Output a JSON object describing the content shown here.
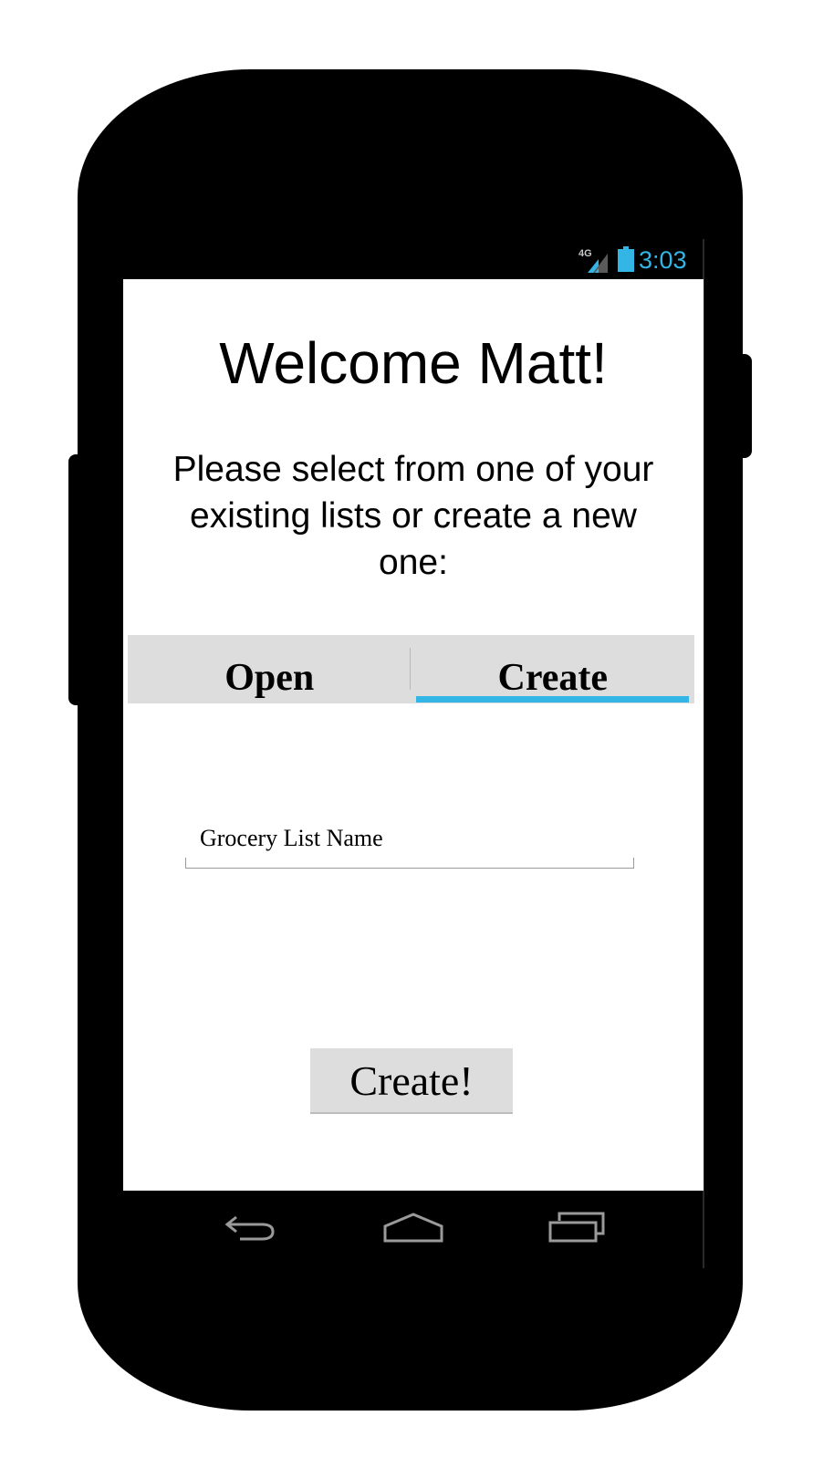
{
  "status_bar": {
    "network_label": "4G",
    "time": "3:03",
    "accent_color": "#33b5e5"
  },
  "screen": {
    "title": "Welcome Matt!",
    "subtitle": "Please select from one of your existing lists or create a new one:",
    "tabs": [
      {
        "label": "Open",
        "selected": false
      },
      {
        "label": "Create",
        "selected": true
      }
    ],
    "name_field": {
      "placeholder": "Grocery List Name"
    },
    "create_button_label": "Create!"
  },
  "nav_bar": {
    "icons": [
      "back-icon",
      "home-icon",
      "recent-apps-icon"
    ]
  }
}
